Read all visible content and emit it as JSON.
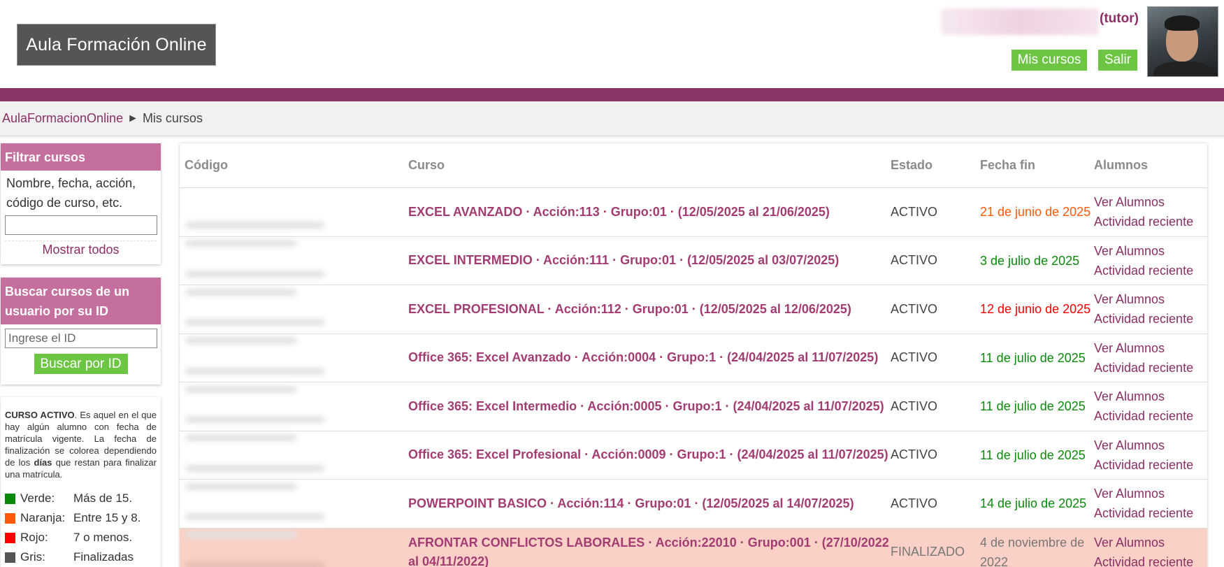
{
  "header": {
    "logo_text": "Aula Formación Online",
    "user_role": "(tutor)",
    "mis_cursos_label": "Mis cursos",
    "salir_label": "Salir"
  },
  "breadcrumb": {
    "home": "AulaFormacionOnline",
    "separator": "►",
    "current": "Mis cursos"
  },
  "filter": {
    "title": "Filtrar cursos",
    "description": "Nombre, fecha, acción, código de curso, etc.",
    "show_all": "Mostrar todos"
  },
  "search": {
    "title": "Buscar cursos de un usuario por su ID",
    "placeholder": "Ingrese el ID",
    "button": "Buscar por ID"
  },
  "legend": {
    "term": "CURSO ACTIVO",
    "text1": ". Es aquel en el que hay algún alumno con fecha de matrícula vigente. La fecha de finalización se colorea dependiendo de los ",
    "bold": "días",
    "text2": " que restan para finalizar una matrícula.",
    "items": [
      {
        "name": "Verde:",
        "desc": "Más de 15.",
        "color": "#0a8a0a"
      },
      {
        "name": "Naranja:",
        "desc": "Entre 15 y 8.",
        "color": "#ff5a0a"
      },
      {
        "name": "Rojo:",
        "desc": "7 o menos.",
        "color": "#ff0000"
      },
      {
        "name": "Gris:",
        "desc": "Finalizadas",
        "color": "#555555"
      }
    ]
  },
  "table": {
    "headers": {
      "code": "Código",
      "course": "Curso",
      "state": "Estado",
      "date": "Fecha fin",
      "students": "Alumnos"
    },
    "link_students": "Ver Alumnos",
    "link_activity": "Actividad reciente",
    "rows": [
      {
        "course": "EXCEL AVANZADO · Acción:113 · Grupo:01 · (12/05/2025 al 21/06/2025)",
        "state": "ACTIVO",
        "date": "21 de junio de 2025",
        "date_color": "#ff5a0a",
        "finished": false
      },
      {
        "course": "EXCEL INTERMEDIO · Acción:111 · Grupo:01 · (12/05/2025 al 03/07/2025)",
        "state": "ACTIVO",
        "date": "3 de julio de 2025",
        "date_color": "#0a8a0a",
        "finished": false
      },
      {
        "course": "EXCEL PROFESIONAL · Acción:112 · Grupo:01 · (12/05/2025 al 12/06/2025)",
        "state": "ACTIVO",
        "date": "12 de junio de 2025",
        "date_color": "#ff0000",
        "finished": false
      },
      {
        "course": "Office 365: Excel Avanzado · Acción:0004 · Grupo:1 · (24/04/2025 al 11/07/2025)",
        "state": "ACTIVO",
        "date": "11 de julio de 2025",
        "date_color": "#0a8a0a",
        "finished": false
      },
      {
        "course": "Office 365: Excel Intermedio · Acción:0005 · Grupo:1 · (24/04/2025 al 11/07/2025)",
        "state": "ACTIVO",
        "date": "11 de julio de 2025",
        "date_color": "#0a8a0a",
        "finished": false
      },
      {
        "course": "Office 365: Excel Profesional · Acción:0009 · Grupo:1 · (24/04/2025 al 11/07/2025)",
        "state": "ACTIVO",
        "date": "11 de julio de 2025",
        "date_color": "#0a8a0a",
        "finished": false
      },
      {
        "course": "POWERPOINT BASICO · Acción:114 · Grupo:01 · (12/05/2025 al 14/07/2025)",
        "state": "ACTIVO",
        "date": "14 de julio de 2025",
        "date_color": "#0a8a0a",
        "finished": false
      },
      {
        "course": "AFRONTAR CONFLICTOS LABORALES · Acción:22010 · Grupo:001 · (27/10/2022 al 04/11/2022)",
        "state": "FINALIZADO",
        "date": "4 de noviembre de 2022",
        "date_color": "#777777",
        "finished": true
      }
    ]
  }
}
